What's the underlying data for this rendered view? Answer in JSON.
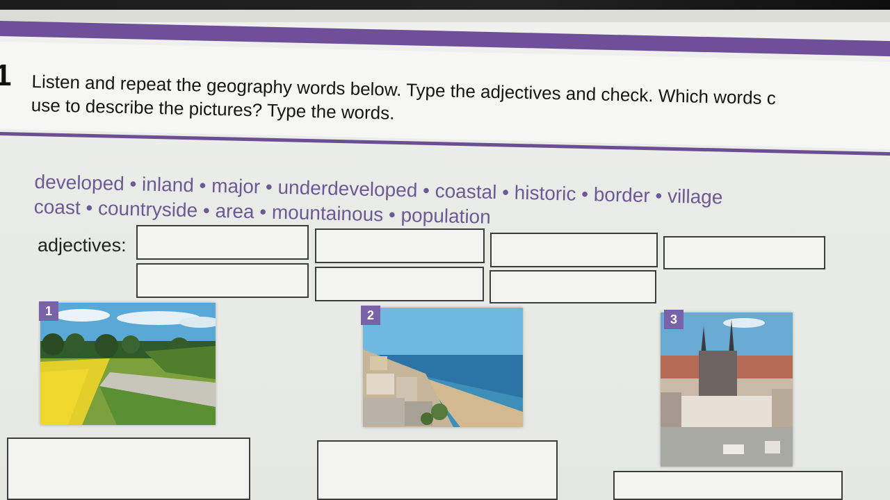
{
  "exercise": {
    "number": "1",
    "instruction_line1": "Listen and repeat the geography words below. Type the adjectives and check. Which words c",
    "instruction_line2": "use to describe the pictures? Type the words."
  },
  "word_bank": {
    "line1": "developed • inland • major • underdeveloped • coastal • historic • border • village",
    "line2": "coast • countryside • area • mountainous • population"
  },
  "adjectives_label": "adjectives:",
  "pictures": [
    {
      "badge": "1",
      "subject": "countryside field"
    },
    {
      "badge": "2",
      "subject": "coastal town"
    },
    {
      "badge": "3",
      "subject": "historic city"
    }
  ],
  "colors": {
    "accent_purple": "#6e4f98",
    "word_bank_text": "#6b5a95",
    "badge": "#7a62a6"
  }
}
